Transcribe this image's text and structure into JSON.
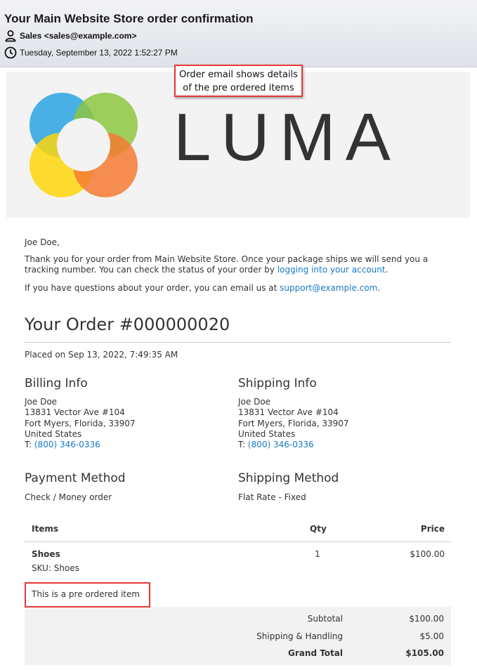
{
  "email": {
    "subject": "Your Main Website Store order confirmation",
    "from": "Sales <sales@example.com>",
    "date": "Tuesday, September 13, 2022 1:52:27 PM"
  },
  "logo": {
    "wordmark": "LUMA"
  },
  "callout": {
    "line1": "Order email shows details",
    "line2": "of the pre ordered items"
  },
  "message": {
    "greeting": "Joe Doe,",
    "thanks_pre": "Thank you for your order from Main Website Store. Once your package ships we will send you a",
    "thanks_line2_pre": "tracking number. You can check the status of your order by ",
    "thanks_link": "logging into your account",
    "thanks_line2_post": ".",
    "questions_pre": "If you have questions about your order, you can email us at ",
    "questions_link": "support@example.com",
    "questions_post": "."
  },
  "order": {
    "title": "Your Order #000000020",
    "placed": "Placed on Sep 13, 2022, 7:49:35 AM"
  },
  "billing": {
    "heading": "Billing Info",
    "name": "Joe Doe",
    "street": "13831 Vector Ave #104",
    "city": "Fort Myers, Florida, 33907",
    "country": "United States",
    "phone_prefix": "T: ",
    "phone": "(800) 346-0336"
  },
  "shipping": {
    "heading": "Shipping Info",
    "name": "Joe Doe",
    "street": "13831 Vector Ave #104",
    "city": "Fort Myers, Florida, 33907",
    "country": "United States",
    "phone_prefix": "T: ",
    "phone": "(800) 346-0336"
  },
  "payment": {
    "heading": "Payment Method",
    "value": "Check / Money order"
  },
  "shipping_method": {
    "heading": "Shipping Method",
    "value": "Flat Rate - Fixed"
  },
  "items": {
    "headers": {
      "items": "Items",
      "qty": "Qty",
      "price": "Price"
    },
    "rows": [
      {
        "name": "Shoes",
        "sku": "SKU: Shoes",
        "qty": "1",
        "price": "$100.00"
      }
    ],
    "preorder_note": "This is a pre ordered item"
  },
  "totals": {
    "subtotal_label": "Subtotal",
    "subtotal": "$100.00",
    "shipping_label": "Shipping & Handling",
    "shipping": "$5.00",
    "grand_label": "Grand Total",
    "grand": "$105.00"
  },
  "colors": {
    "link": "#1979c3",
    "highlight": "#e53935",
    "logo_blue": "#29a3e0",
    "logo_green": "#8dc63f",
    "logo_yellow": "#fdd60b",
    "logo_orange": "#f47a32"
  },
  "icons": {
    "from": "person-icon",
    "date": "clock-icon"
  }
}
